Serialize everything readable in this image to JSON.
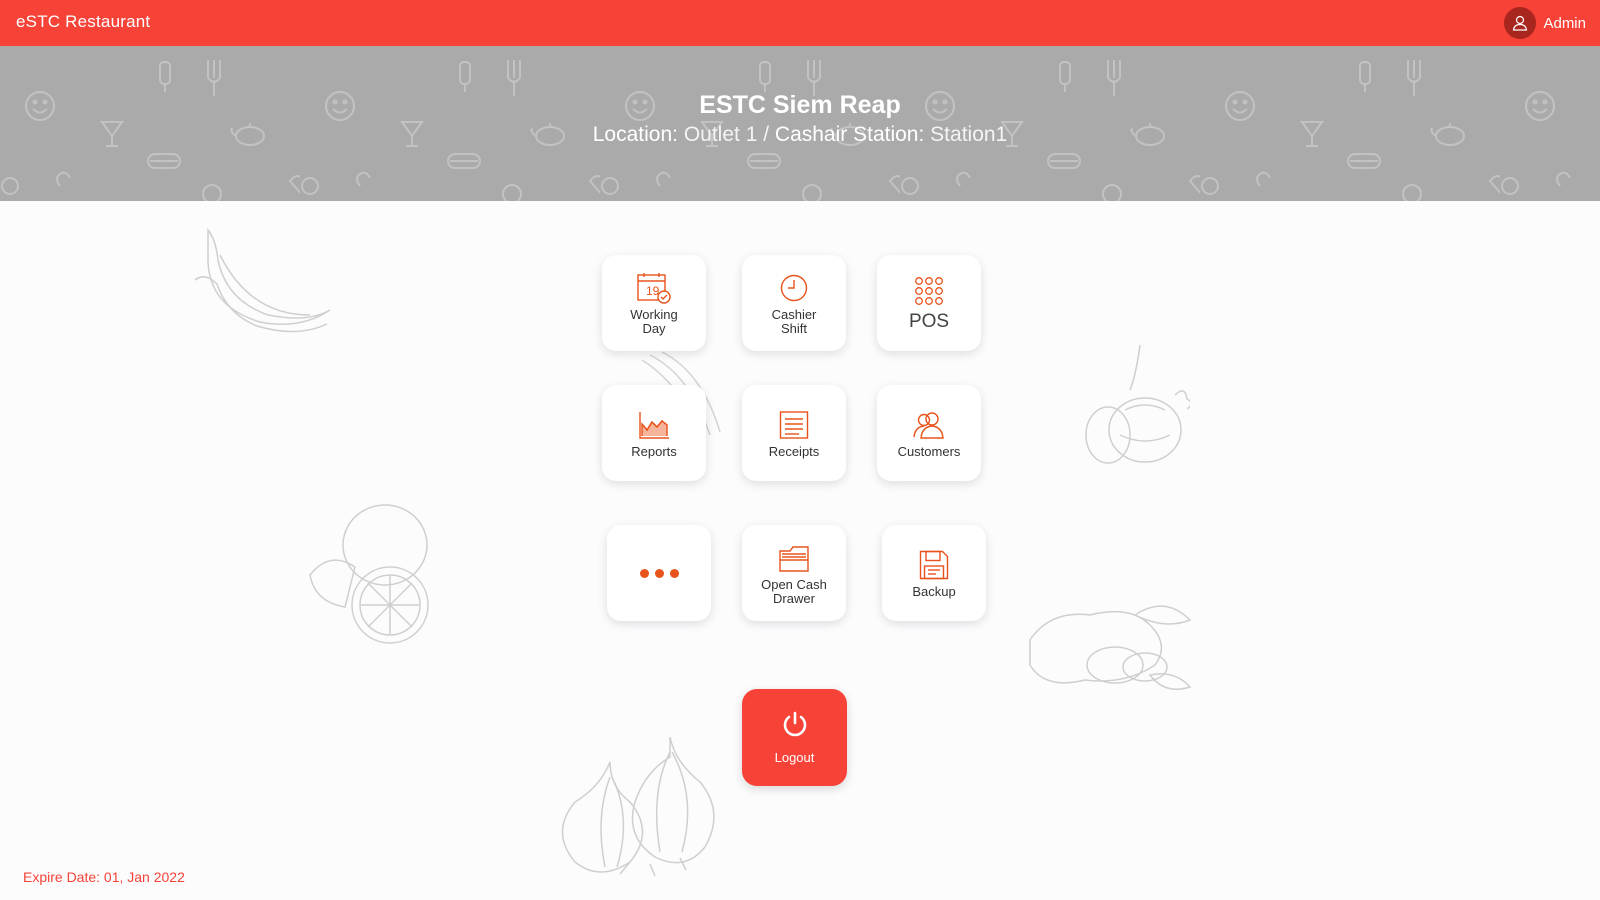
{
  "header": {
    "app_title": "eSTC Restaurant",
    "user_name": "Admin",
    "user_icon": "user-icon"
  },
  "banner": {
    "outlet_name": "ESTC Siem Reap",
    "location_label": "Location:",
    "location_value": "Outlet 1",
    "separator": "/",
    "station_label": "Cashair Station:",
    "station_value": "Station1"
  },
  "menu": {
    "working_day": {
      "label": "Working Day",
      "icon": "calendar-icon"
    },
    "cashier_shift": {
      "label": "Cashier Shift",
      "icon": "clock-icon"
    },
    "pos": {
      "label": "POS",
      "icon": "keypad-icon"
    },
    "reports": {
      "label": "Reports",
      "icon": "chart-icon"
    },
    "receipts": {
      "label": "Receipts",
      "icon": "receipt-icon"
    },
    "customers": {
      "label": "Customers",
      "icon": "customers-icon"
    },
    "more": {
      "icon": "more-icon"
    },
    "open_cash_drawer": {
      "label": "Open Cash Drawer",
      "icon": "drawer-icon"
    },
    "backup": {
      "label": "Backup",
      "icon": "floppy-icon"
    },
    "logout": {
      "label": "Logout",
      "icon": "power-icon"
    }
  },
  "footer": {
    "expire_text": "Expire Date: 01, Jan 2022"
  },
  "colors": {
    "accent": "#f64237",
    "icon": "#e8531c",
    "banner": "#aaaaaa"
  }
}
